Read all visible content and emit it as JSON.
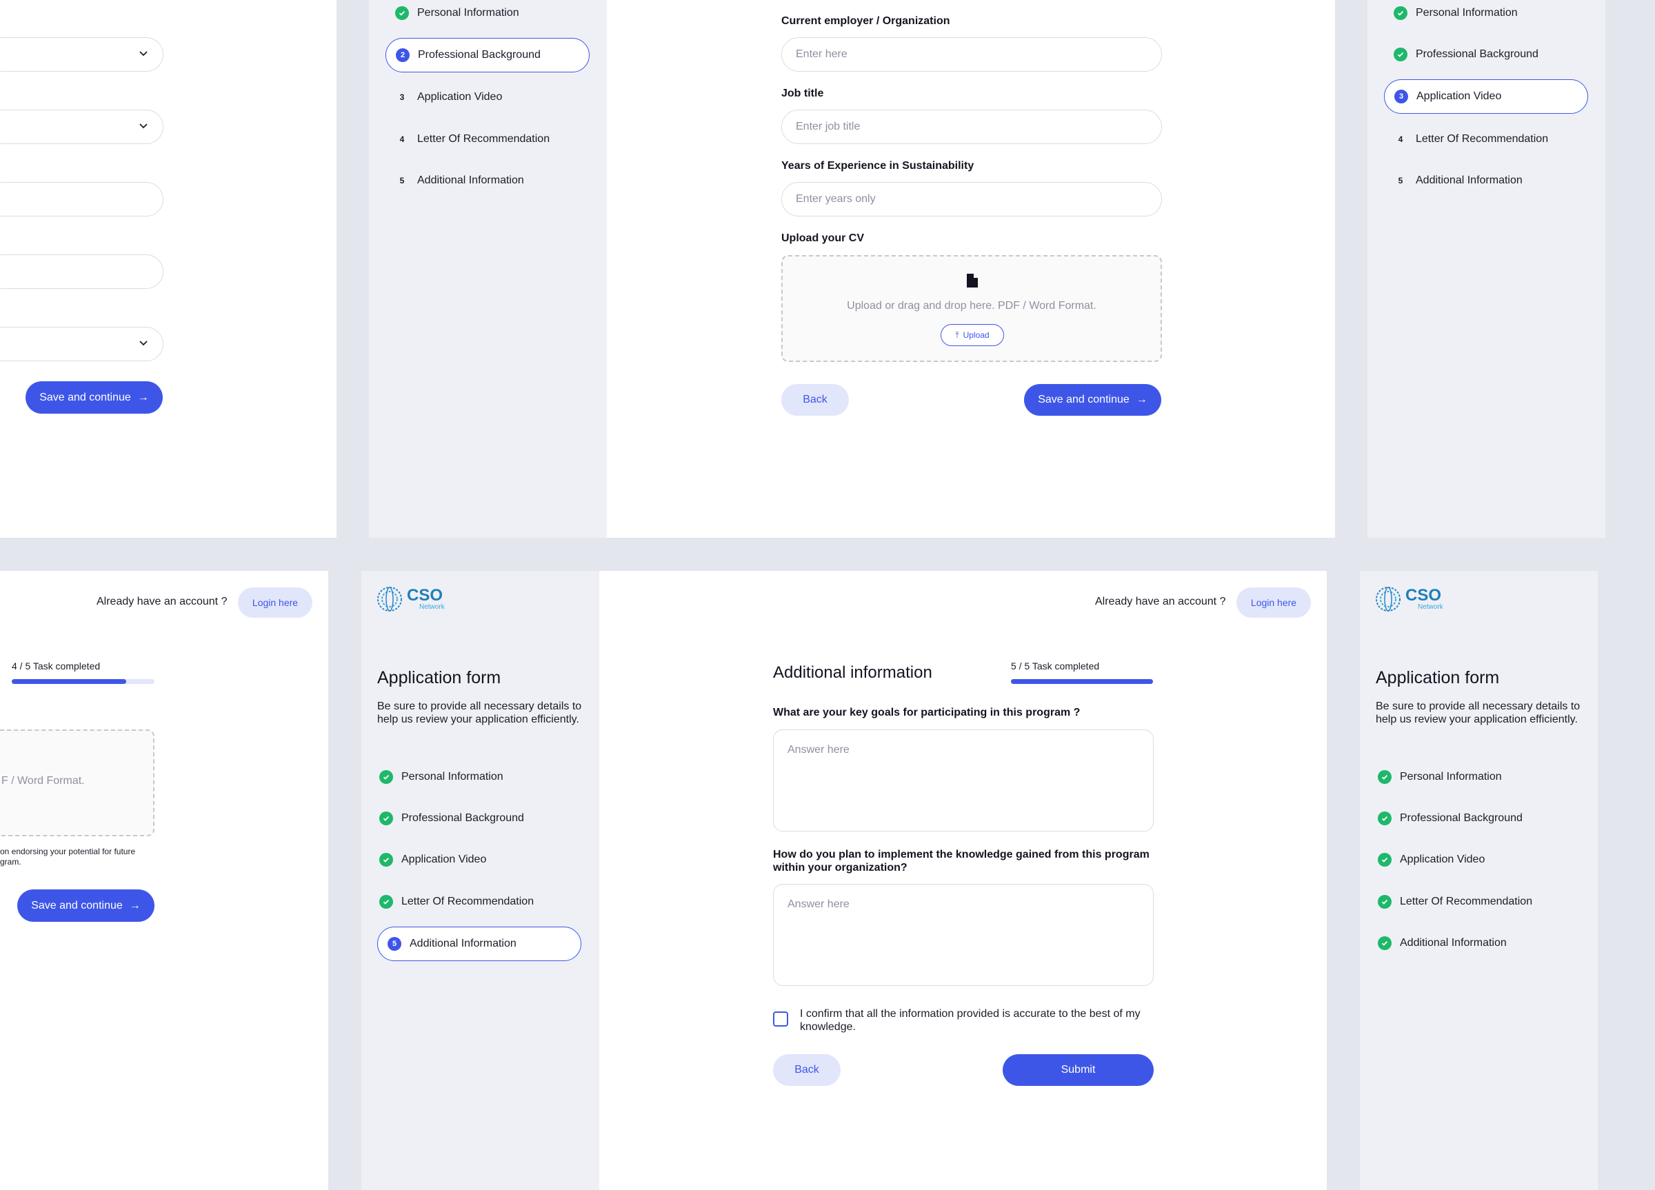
{
  "header": {
    "already_account": "Already have an account ?",
    "login_label": "Login here"
  },
  "sidebar": {
    "title": "Application form",
    "description": "Be sure to provide all necessary details to help us review your application efficiently.",
    "steps": [
      {
        "num": "1",
        "label": "Personal Information"
      },
      {
        "num": "2",
        "label": "Professional Background"
      },
      {
        "num": "3",
        "label": "Application Video"
      },
      {
        "num": "4",
        "label": "Letter Of Recommendation"
      },
      {
        "num": "5",
        "label": "Additional Information"
      }
    ]
  },
  "logo": {
    "text": "CSO",
    "sub": "Network"
  },
  "buttons": {
    "save_continue": "Save and continue",
    "back": "Back",
    "submit": "Submit",
    "upload": "Upload"
  },
  "professional": {
    "employer_label": "Current employer / Organization",
    "employer_placeholder": "Enter here",
    "job_label": "Job title",
    "job_placeholder": "Enter job title",
    "years_label": "Years of Experience in Sustainability",
    "years_placeholder": "Enter years only",
    "cv_label": "Upload your CV",
    "cv_hint": "Upload or drag and drop here. PDF / Word Format."
  },
  "letter": {
    "progress_text": "4 / 5 Task completed",
    "progress_value": 0.8,
    "upload_hint_partial": "F / Word Format.",
    "note_line1": "on endorsing your potential for future",
    "note_line2": "gram."
  },
  "additional": {
    "title": "Additional information",
    "progress_text": "5 / 5 Task completed",
    "progress_value": 1.0,
    "q1": "What are your key goals for participating in this program ?",
    "q1_placeholder": "Answer here",
    "q2": "How do you plan to implement the knowledge gained from this program within your organization?",
    "q2_placeholder": "Answer here",
    "confirm": "I confirm that all the information provided is accurate to the best of my knowledge."
  },
  "colors": {
    "accent": "#3e56e8",
    "success": "#1eb86a",
    "sidebar_bg": "#eef0f6",
    "page_bg": "#e4e6ee"
  }
}
